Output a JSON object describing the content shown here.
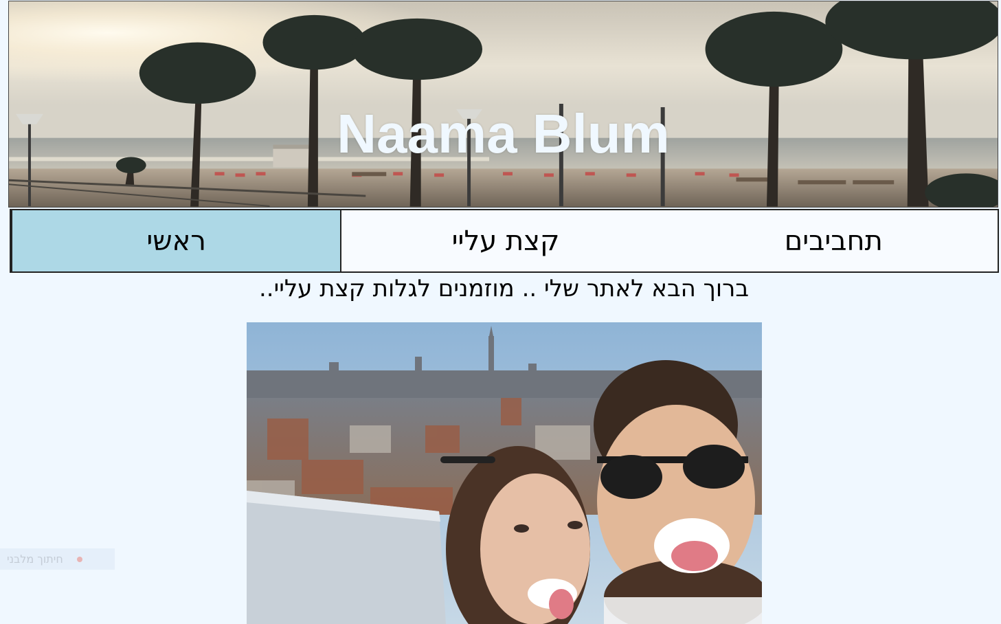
{
  "header": {
    "site_title": "Naama Blum"
  },
  "nav": {
    "items": [
      {
        "label": "ראשי",
        "active": true
      },
      {
        "label": "קצת עליי",
        "active": false
      },
      {
        "label": "תחביבים",
        "active": false
      }
    ]
  },
  "main": {
    "welcome_text": "ברוך הבא לאתר שלי .. מוזמנים לגלות קצת עליי.."
  },
  "widget": {
    "label": "חיתוך מלבני"
  },
  "colors": {
    "page_background": "#f0f8ff",
    "active_nav": "#add8e6",
    "title_text": "#f0f8ff"
  }
}
